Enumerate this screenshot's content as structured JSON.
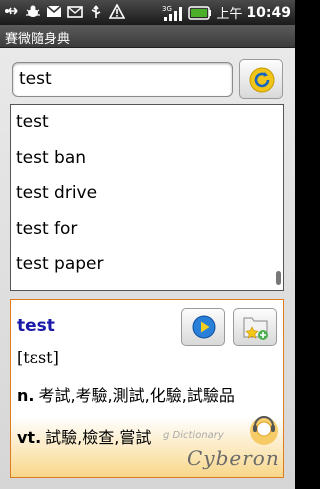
{
  "status_bar": {
    "time": "10:49",
    "ampm": "上午",
    "network": "3G",
    "icons": [
      "usb-icon",
      "usb-debug-icon",
      "gmail-icon",
      "mail-icon",
      "usb-icon",
      "warning-icon",
      "signal-icon",
      "battery-icon"
    ]
  },
  "app": {
    "title": "賽微隨身典"
  },
  "search": {
    "value": "test"
  },
  "word_list": {
    "items": [
      "test",
      "test ban",
      "test drive",
      "test for",
      "test paper"
    ]
  },
  "definition": {
    "headword": "test",
    "phonetic": "[tɛst]",
    "entries": [
      {
        "pos": "n.",
        "meaning": "考試,考驗,測試,化驗,試驗品"
      },
      {
        "pos": "vt.",
        "meaning": "試驗,檢查,嘗試"
      }
    ],
    "watermark": "g Dictionary",
    "brand": "Cyberon"
  },
  "colors": {
    "headword": "#1a1aa8",
    "panel_border": "#e07b1e",
    "play_blue": "#2a7fd8",
    "refresh_yellow": "#f0c419"
  }
}
